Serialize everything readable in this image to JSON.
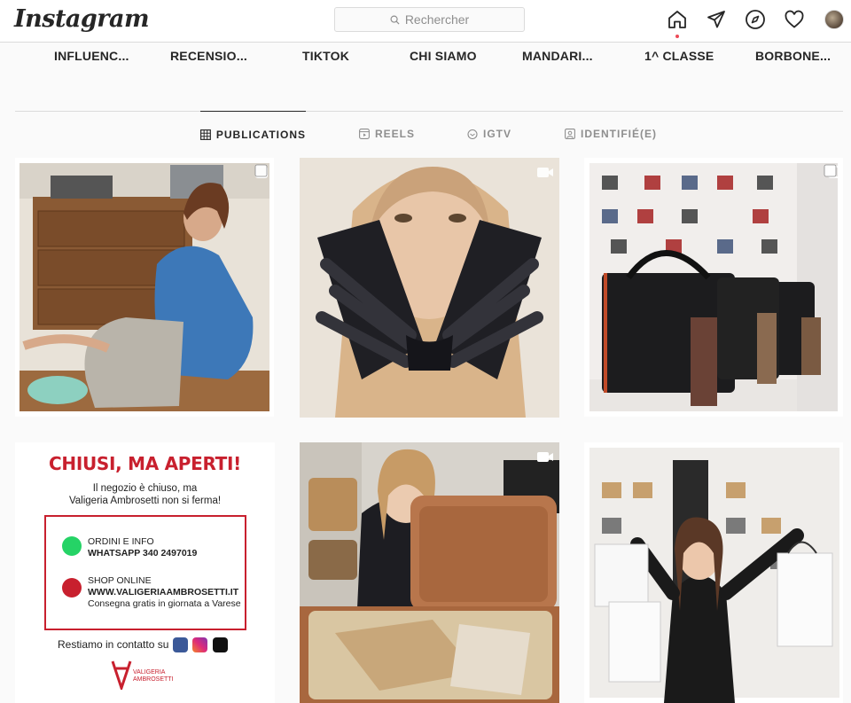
{
  "app": {
    "logo": "Instagram"
  },
  "search": {
    "placeholder": "Rechercher"
  },
  "nav": {
    "icons": [
      "home-icon",
      "direct-icon",
      "explore-icon",
      "activity-icon",
      "profile-avatar"
    ]
  },
  "highlights": [
    "INFLUENC...",
    "RECENSIO...",
    "TIKTOK",
    "CHI SIAMO",
    "MANDARI...",
    "1^ CLASSE",
    "BORBONE..."
  ],
  "tabs": [
    {
      "label": "PUBLICATIONS",
      "active": true
    },
    {
      "label": "REELS",
      "active": false
    },
    {
      "label": "IGTV",
      "active": false
    },
    {
      "label": "IDENTIFIÉ(E)",
      "active": false
    }
  ],
  "posts": [
    {
      "type": "carousel",
      "icon": "carousel-icon"
    },
    {
      "type": "video",
      "icon": "video-icon"
    },
    {
      "type": "carousel",
      "icon": "carousel-icon"
    },
    {
      "type": "image",
      "icon": ""
    },
    {
      "type": "video",
      "icon": "video-icon"
    },
    {
      "type": "image",
      "icon": ""
    }
  ],
  "poster": {
    "title": "CHIUSI, MA APERTI!",
    "line1": "Il negozio è chiuso, ma",
    "line2": "Valigeria Ambrosetti non si ferma!",
    "order_label": "ORDINI E INFO",
    "order_value": "WHATSAPP 340 2497019",
    "shop_label": "SHOP ONLINE",
    "shop_value": "WWW.VALIGERIAAMBROSETTI.IT",
    "shop_note": "Consegna gratis in giornata a Varese",
    "contact": "Restiamo in contatto su",
    "brand_line1": "VALIGERIA",
    "brand_line2": "AMBROSETTI"
  },
  "colors": {
    "accent_red": "#c8202e",
    "notification_dot": "#ed4956",
    "whatsapp_green": "#25d366"
  }
}
